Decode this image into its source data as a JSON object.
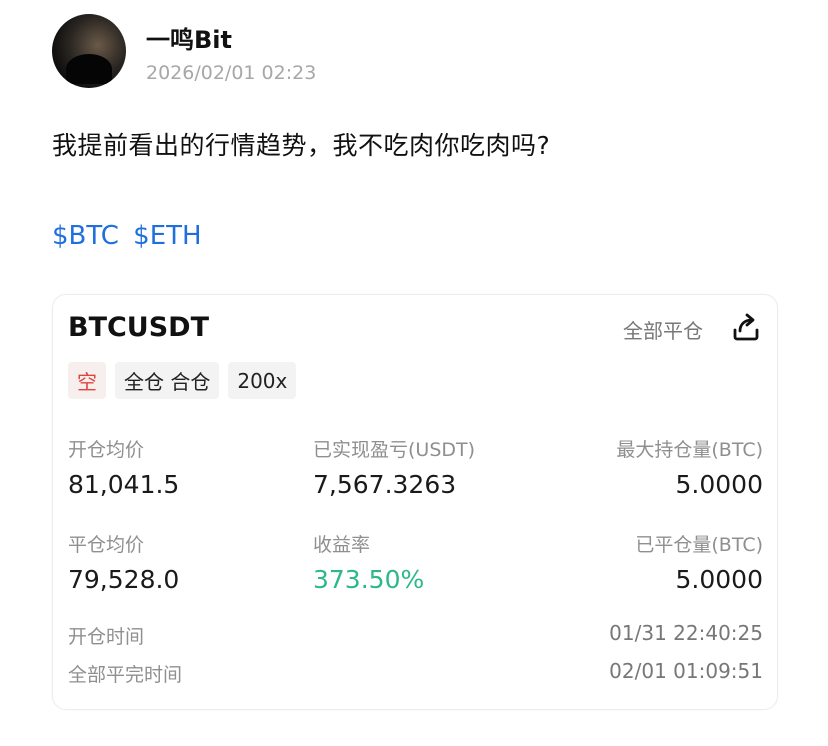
{
  "post": {
    "username": "一鸣Bit",
    "timestamp": "2026/02/01 02:23",
    "text": "我提前看出的行情趋势，我不吃肉你吃肉吗?",
    "tags": [
      "$BTC",
      "$ETH"
    ]
  },
  "card": {
    "symbol": "BTCUSDT",
    "close_all_label": "全部平仓",
    "chips": {
      "direction": "空",
      "margin_mode": "全仓 合仓",
      "leverage": "200x"
    },
    "open_avg_price_label": "开仓均价",
    "open_avg_price": "81,041.5",
    "realized_pnl_label": "已实现盈亏(USDT)",
    "realized_pnl": "7,567.3263",
    "max_position_label": "最大持仓量(BTC)",
    "max_position": "5.0000",
    "close_avg_price_label": "平仓均价",
    "close_avg_price": "79,528.0",
    "roi_label": "收益率",
    "roi": "373.50%",
    "closed_position_label": "已平仓量(BTC)",
    "closed_position": "5.0000",
    "open_time_label": "开仓时间",
    "open_time": "01/31 22:40:25",
    "close_time_label": "全部平完时间",
    "close_time": "02/01 01:09:51"
  },
  "colors": {
    "link": "#1f6fdc",
    "short": "#e0443c",
    "profit": "#2bb98a"
  }
}
